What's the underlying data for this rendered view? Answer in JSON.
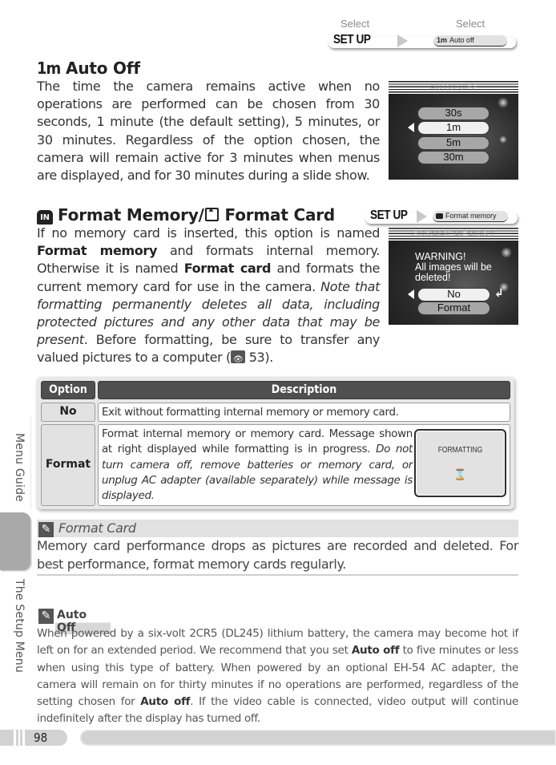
{
  "breadcrumb": {
    "select_label_1": "Select",
    "select_label_2": "Select",
    "menu": "SET UP",
    "item_icon": "1m",
    "item": "Auto off"
  },
  "auto_off": {
    "icon": "1m",
    "title": "Auto Off",
    "body": "The time the camera remains active when no operations are performed can be chosen from 30 seconds, 1 minute (the default setting), 5 minutes, or 30 minutes. Regardless of the option chosen, the camera will remain active for 3 minutes when menus are displayed, and for 30 minutes during a slide show.",
    "screen": {
      "title": "AUTO OFF",
      "options": [
        "30s",
        "1m",
        "5m",
        "30m"
      ],
      "selected": "1m"
    }
  },
  "format": {
    "icon_in": "IN",
    "title_part1": "Format Memory/",
    "title_part2": "Format Card",
    "breadcrumb_menu": "SET UP",
    "breadcrumb_item": "Format memory",
    "body": {
      "t1": "If no memory card is inserted, this option is named ",
      "b1": "Format memory",
      "t2": " and formats internal memory.  Otherwise it is named ",
      "b2": "Format card",
      "t3": " and formats the current memory card for use in the camera.  ",
      "i1": "Note that formatting permanently deletes all data, including protected pictures and any other data that may be present",
      "t4": ".  Before formatting, be sure to transfer any valued pictures to a computer (",
      "ref_page": "53",
      "t5": ")."
    },
    "screen": {
      "title": "FORMAT MEMORY",
      "warning_1": "WARNING!",
      "warning_2": "All images will be",
      "warning_3": "deleted!",
      "options": [
        "No",
        "Format"
      ],
      "selected": "No"
    }
  },
  "table": {
    "headers": [
      "Option",
      "Description"
    ],
    "rows": [
      {
        "option": "No",
        "description": "Exit without formatting internal memory or memory card."
      },
      {
        "option": "Format",
        "description": "Format internal memory or memory card.  Message shown at right displayed while formatting is in progress.",
        "warning": "Do not turn camera off, remove batteries or memory card, or unplug AC adapter (available separately) while message is displayed.",
        "screen_label": "FORMATTING"
      }
    ]
  },
  "note_format_card": {
    "title": "Format Card",
    "body": "Memory card performance drops as pictures are recorded and deleted.  For best performance, format memory cards regularly."
  },
  "note_auto_off": {
    "title": "Auto Off",
    "t1": "When powered by a six-volt 2CR5 (DL245) lithium battery, the camera may become hot if left on for an extended period.  We recommend that you set ",
    "b1": "Auto off",
    "t2": " to five minutes or less when using this type of battery.  When powered by an optional EH-54 AC adapter, the camera will remain on for thirty minutes if no operations are performed, regardless of the setting chosen for ",
    "b2": "Auto off",
    "t3": ".  If the video cable is connected, video output will continue indefinitely after the display has turned off."
  },
  "side_tabs": {
    "upper": "Menu Guide",
    "lower": "The Setup Menu"
  },
  "footer": {
    "page_number": "98"
  }
}
